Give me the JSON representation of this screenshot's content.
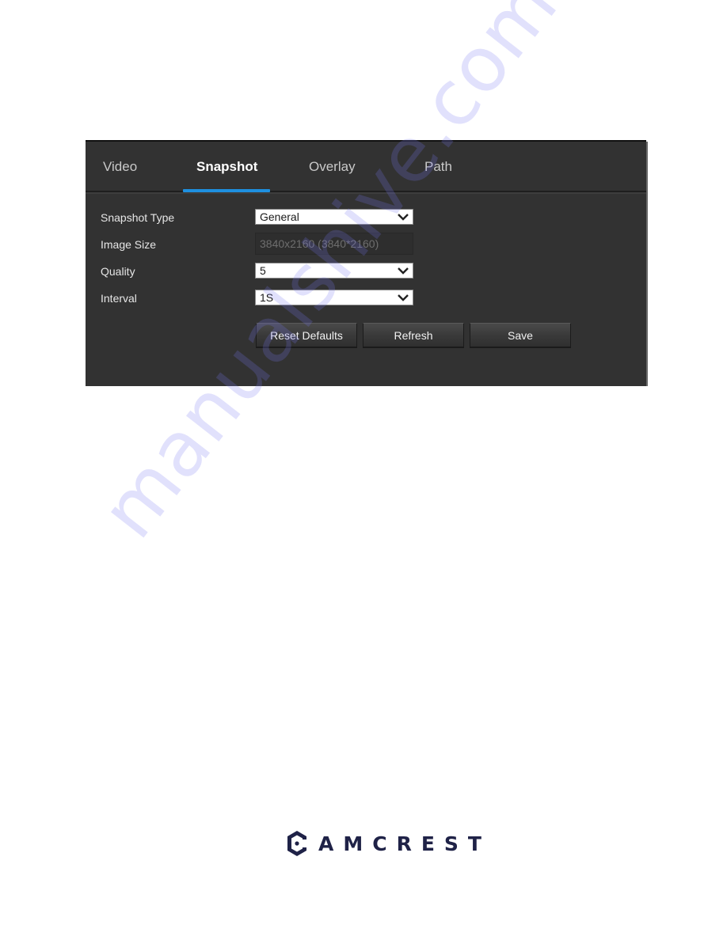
{
  "tabs": [
    {
      "label": "Video",
      "active": false
    },
    {
      "label": "Snapshot",
      "active": true
    },
    {
      "label": "Overlay",
      "active": false
    },
    {
      "label": "Path",
      "active": false
    }
  ],
  "form": {
    "snapshot_type": {
      "label": "Snapshot Type",
      "value": "General"
    },
    "image_size": {
      "label": "Image Size",
      "value": "3840x2160 (3840*2160)"
    },
    "quality": {
      "label": "Quality",
      "value": "5"
    },
    "interval": {
      "label": "Interval",
      "value": "1S"
    }
  },
  "buttons": {
    "reset": "Reset Defaults",
    "refresh": "Refresh",
    "save": "Save"
  },
  "colors": {
    "accent": "#1e90e0",
    "panel_bg": "#323232",
    "brand": "#1f2247"
  },
  "icons": {
    "dropdown": "chevron-down-icon",
    "logo": "amcrest-logo-icon"
  },
  "brand": {
    "name": "AMCREST"
  },
  "watermark": "manualshive.com"
}
